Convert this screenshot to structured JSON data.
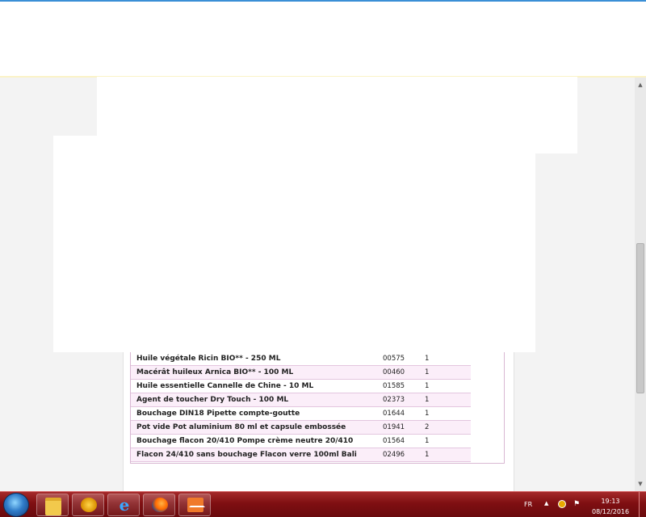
{
  "table": {
    "rows": [
      {
        "name": "Huile végétale Ricin BIO** - 250 ML",
        "code": "00575",
        "qty": "1"
      },
      {
        "name": "Macérât huileux Arnica BIO** - 100 ML",
        "code": "00460",
        "qty": "1"
      },
      {
        "name": "Huile essentielle Cannelle de Chine - 10 ML",
        "code": "01585",
        "qty": "1"
      },
      {
        "name": "Agent de toucher Dry Touch - 100 ML",
        "code": "02373",
        "qty": "1"
      },
      {
        "name": "Bouchage DIN18 Pipette compte-goutte",
        "code": "01644",
        "qty": "1"
      },
      {
        "name": "Pot vide Pot aluminium 80 ml et capsule embossée",
        "code": "01941",
        "qty": "2"
      },
      {
        "name": "Bouchage flacon 20/410 Pompe crème neutre 20/410",
        "code": "01564",
        "qty": "1"
      },
      {
        "name": "Flacon 24/410 sans bouchage Flacon verre 100ml Bali",
        "code": "02496",
        "qty": "1"
      }
    ]
  },
  "taskbar": {
    "apps": [
      "start-icon",
      "folder-icon",
      "app-icon",
      "internet-explorer-icon",
      "firefox-icon",
      "mail-icon"
    ],
    "language": "FR",
    "time": "19:13",
    "date": "08/12/2016"
  },
  "colors": {
    "row_alt": "#fbeef9",
    "row_border": "#e3c6df",
    "taskbar": "#7f0f12"
  }
}
